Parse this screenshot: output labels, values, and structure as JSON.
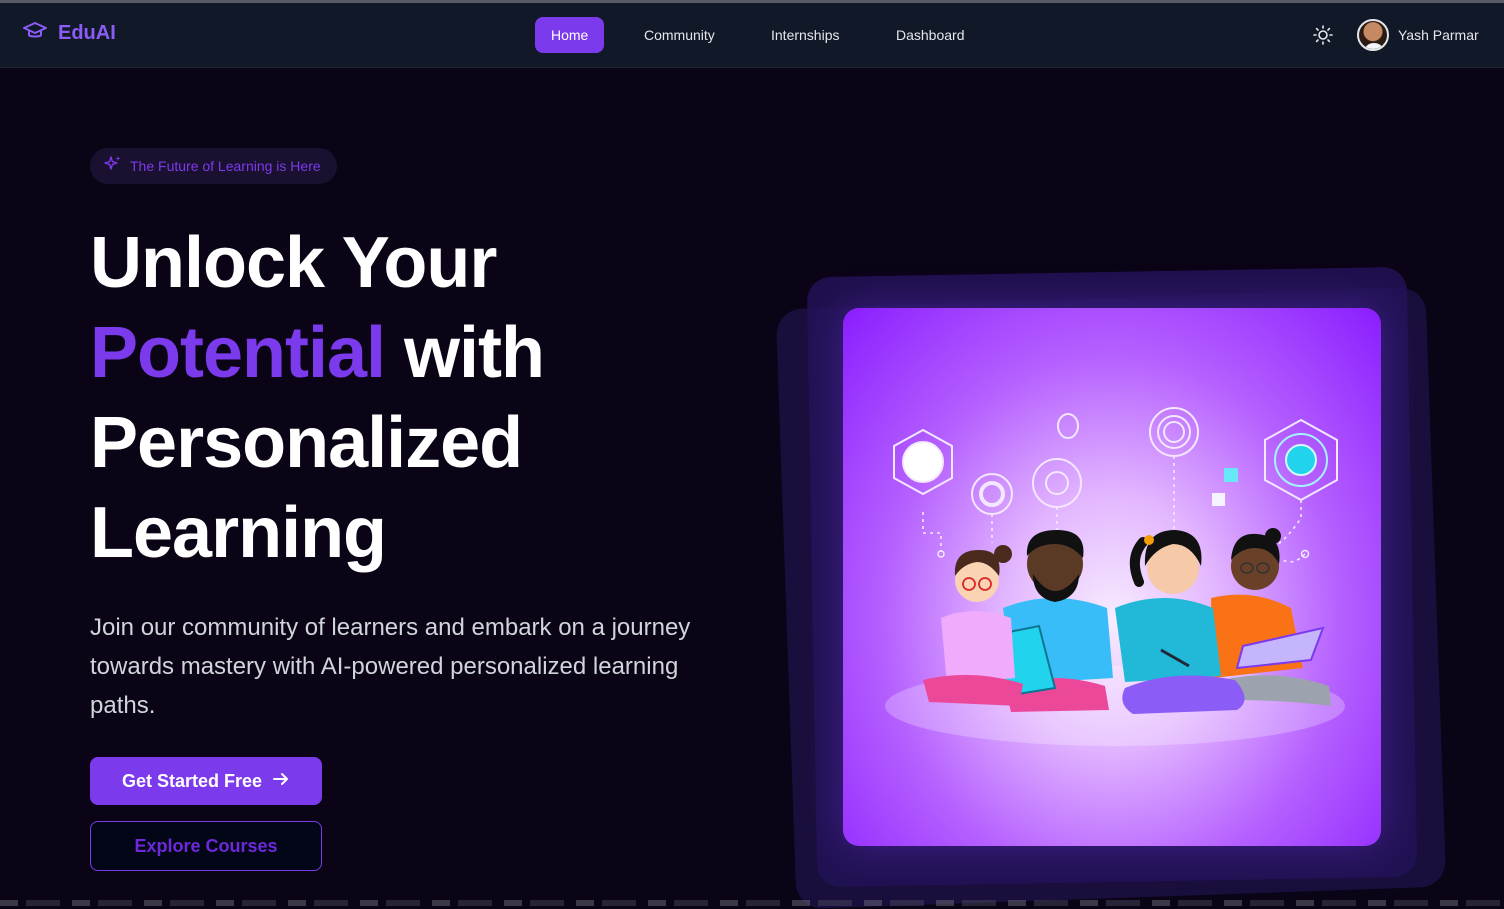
{
  "app": {
    "name": "EduAI"
  },
  "nav": {
    "items": [
      {
        "label": "Home",
        "active": true
      },
      {
        "label": "Community",
        "active": false
      },
      {
        "label": "Internships",
        "active": false
      },
      {
        "label": "Dashboard",
        "active": false
      }
    ]
  },
  "user": {
    "name": "Yash Parmar"
  },
  "hero": {
    "badge": "The Future of Learning is Here",
    "headline_line1": "Unlock Your",
    "headline_accent": "Potential",
    "headline_line2_rest": " with",
    "headline_line3": "Personalized",
    "headline_line4": "Learning",
    "subtitle": "Join our community of learners and embark on a journey towards mastery with AI-powered personalized learning paths.",
    "primary_cta": "Get Started Free",
    "secondary_cta": "Explore Courses"
  },
  "icons": {
    "brand": "graduation-cap-icon",
    "theme_toggle": "sun-icon",
    "badge": "sparkles-icon",
    "primary_cta": "arrow-right-icon"
  },
  "colors": {
    "accent": "#7c3aed",
    "navbar_bg": "#111827",
    "page_bg": "#0b0417",
    "text_primary": "#ffffff",
    "text_secondary": "#d1d5db"
  }
}
